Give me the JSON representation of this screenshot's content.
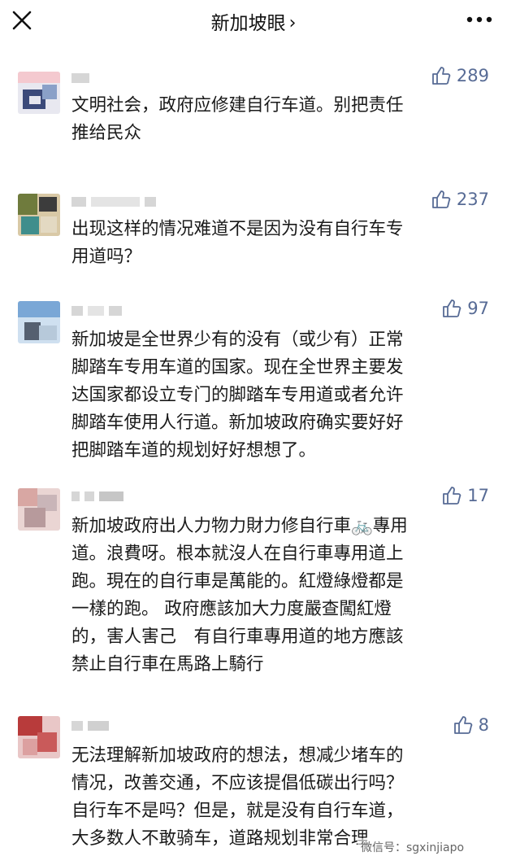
{
  "header": {
    "title": "新加坡眼",
    "chevron": "›",
    "close_icon": "close-icon",
    "more_icon": "more-dots-icon"
  },
  "comments": [
    {
      "likes": "289",
      "text": "文明社会，政府应修建自行车道。别把责任\n推给民众"
    },
    {
      "likes": "237",
      "text": "出现这样的情况难道不是因为没有自行车专\n用道吗？"
    },
    {
      "likes": "97",
      "text": "新加坡是全世界少有的没有（或少有）正常\n脚踏车专用车道的国家。现在全世界主要发\n达国家都设立专门的脚踏车专用道或者允许\n脚踏车使用人行道。新加坡政府确实要好好\n把脚踏车道的规划好好想想了。"
    },
    {
      "likes": "17",
      "text": "新加坡政府出人力物力財力修自行車🚲專用\n道。浪費呀。根本就沒人在自行車專用道上\n跑。現在的自行車是萬能的。紅燈綠燈都是\n一樣的跑。 政府應該加大力度嚴查闖紅燈\n的，害人害己　有自行車專用道的地方應該\n禁止自行車在馬路上騎行"
    },
    {
      "likes": "8",
      "text": "无法理解新加坡政府的想法，想减少堵车的\n情况，改善交通，不应该提倡低碳出行吗？\n自行车不是吗？但是，就是没有自行车道，\n大多数人不敢骑车，道路规划非常合理"
    }
  ],
  "watermark": "微信号：sgxinjiapo",
  "colors": {
    "like": "#576b95",
    "text": "#1a1a1a"
  }
}
